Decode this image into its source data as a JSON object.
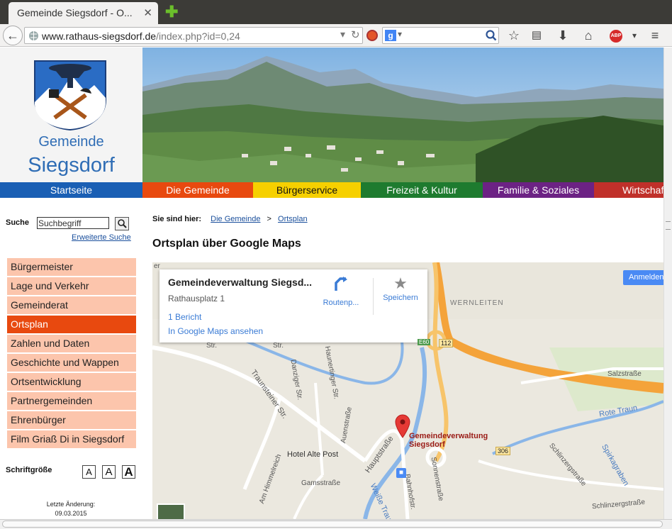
{
  "browser": {
    "tab_title": "Gemeinde Siegsdorf - O...",
    "url_host": "www.rathaus-siegsdorf.de",
    "url_path": "/index.php?id=0,24",
    "search_engine_letter": "g"
  },
  "site": {
    "brand_line1": "Gemeinde",
    "brand_line2": "Siegsdorf",
    "nav": [
      {
        "label": "Startseite",
        "color": "#1a5fb4"
      },
      {
        "label": "Die Gemeinde",
        "color": "#e8490f"
      },
      {
        "label": "Bürgerservice",
        "color": "#f6d000"
      },
      {
        "label": "Freizeit & Kultur",
        "color": "#1e7b2f"
      },
      {
        "label": "Familie & Soziales",
        "color": "#6c2284"
      },
      {
        "label": "Wirtschaft",
        "color": "#c0302a"
      }
    ]
  },
  "sidebar": {
    "search_label": "Suche",
    "search_value": "Suchbegriff",
    "advanced_search": "Erweiterte Suche",
    "menu": [
      "Bürgermeister",
      "Lage und Verkehr",
      "Gemeinderat",
      "Ortsplan",
      "Zahlen und Daten",
      "Geschichte und Wappen",
      "Ortsentwicklung",
      "Partnergemeinden",
      "Ehrenbürger",
      "Film Griaß Di in Siegsdorf"
    ],
    "active_item": "Ortsplan",
    "font_size_label": "Schriftgröße",
    "font_size_buttons": [
      "A",
      "A",
      "A"
    ],
    "last_change_label": "Letzte Änderung:",
    "last_change_date": "09.03.2015"
  },
  "main": {
    "breadcrumb_label": "Sie sind hier:",
    "breadcrumb": [
      "Die Gemeinde",
      ">",
      "Ortsplan"
    ],
    "page_title": "Ortsplan über Google Maps"
  },
  "map": {
    "place_name": "Gemeindeverwaltung Siegsd...",
    "address": "Rathausplatz 1",
    "reviews": "1 Bericht",
    "view_link": "In Google Maps ansehen",
    "route_label": "Routenp...",
    "save_label": "Speichern",
    "signin_label": "Anmelden",
    "pin_label_1": "Gemeindeverwaltung",
    "pin_label_2": "Siegsdorf",
    "labels": {
      "wernleiten": "WERNLEITEN",
      "e60": "E60",
      "r112": "112",
      "r306": "306",
      "salzstrasse": "Salzstraße",
      "rote_traun": "Rote Traun",
      "spirkagraben": "Spirkagraben",
      "schlinzergstrasse": "Schlinzergstraße",
      "schlinzergstrasse2": "Schlinzergstraße",
      "traunsteiner": "Traunsteiner Str.",
      "danziger": "Danziger Str.",
      "haunertinger": "Haunertinger Str.",
      "auenstrasse": "Auenstraße",
      "hauptstrasse": "Hauptstraße",
      "hotel": "Hotel Alte Post",
      "am_himmelreich": "Am Himmelreich",
      "gamsstrasse": "Gamsstraße",
      "bahnhofstr": "Bahnhofstr.",
      "sonnenstrasse": "Sonnenstraße",
      "weisse_traun": "Weiße Traun",
      "west_str": "Str.",
      "ost_str": "Str.",
      "top_left": "er"
    }
  },
  "colors": {
    "brand_blue": "#2f6db5",
    "menu_bg": "#fcc5ac",
    "menu_active": "#e8490f",
    "link": "#1a4f9c"
  }
}
